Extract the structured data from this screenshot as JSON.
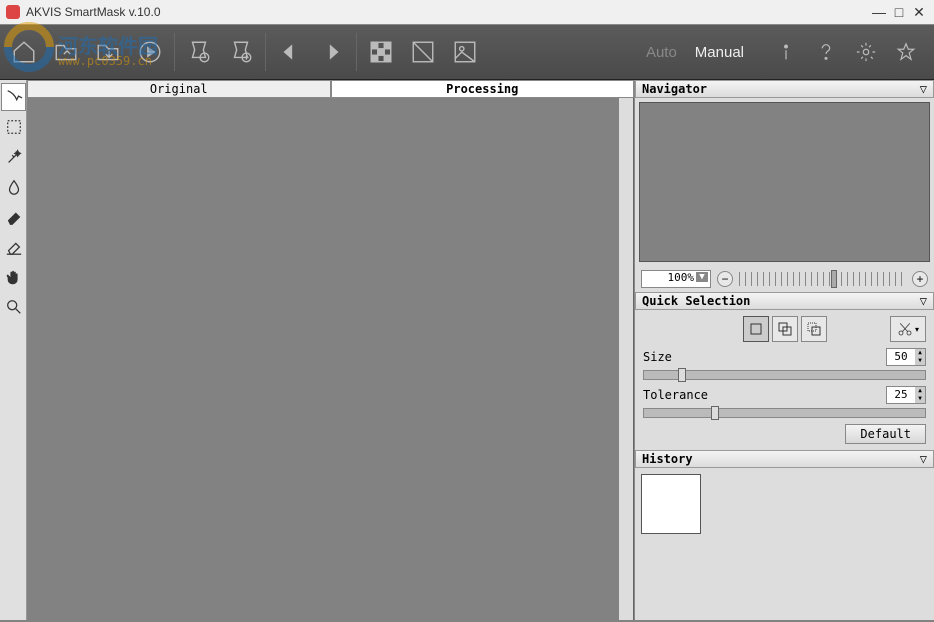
{
  "titlebar": {
    "title": "AKVIS SmartMask v.10.0"
  },
  "watermark": {
    "text1": "河东软件园",
    "text2": "www.pc0359.cn"
  },
  "modes": {
    "auto": "Auto",
    "manual": "Manual",
    "active": "manual"
  },
  "canvas_tabs": {
    "original": "Original",
    "processing": "Processing",
    "active": "processing"
  },
  "panels": {
    "navigator": {
      "title": "Navigator",
      "zoom": "100%"
    },
    "quick_selection": {
      "title": "Quick Selection",
      "size_label": "Size",
      "size_value": "50",
      "tolerance_label": "Tolerance",
      "tolerance_value": "25",
      "default_btn": "Default"
    },
    "history": {
      "title": "History"
    }
  }
}
